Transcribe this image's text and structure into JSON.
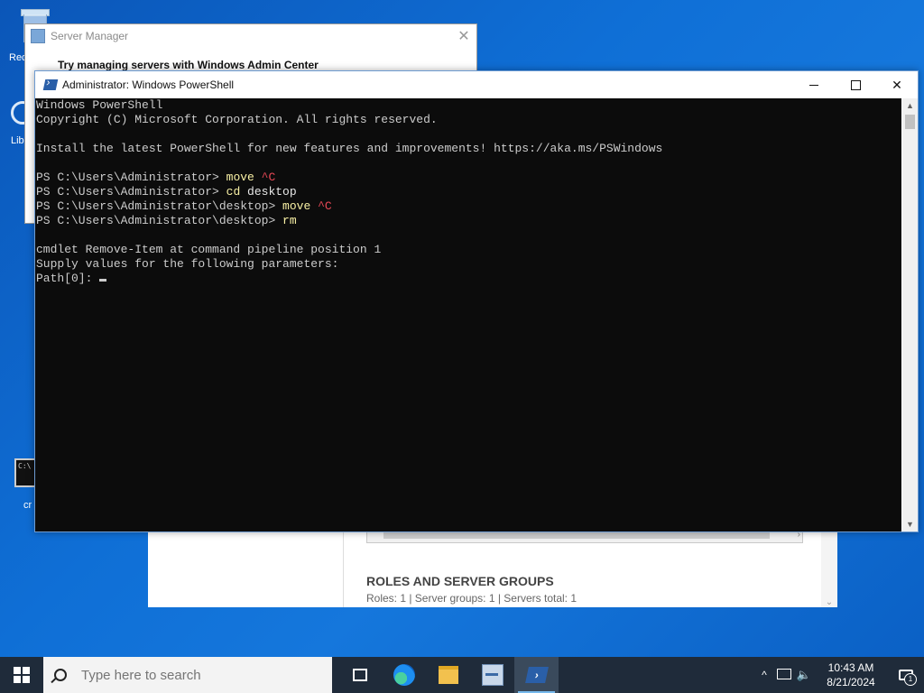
{
  "desktop": {
    "icons": [
      {
        "label": "Rec"
      },
      {
        "label": "Lib"
      },
      {
        "label": "cr"
      }
    ],
    "cmd_icon_text": "C:\\"
  },
  "server_manager": {
    "title": "Server Manager",
    "banner": "Try managing servers with Windows Admin Center",
    "roles_title": "ROLES AND SERVER GROUPS",
    "roles_meta": "Roles: 1   |   Server groups: 1   |   Servers total: 1"
  },
  "powershell": {
    "title": "Administrator: Windows PowerShell",
    "lines": [
      {
        "text": "Windows PowerShell"
      },
      {
        "text": "Copyright (C) Microsoft Corporation. All rights reserved."
      },
      {
        "text": ""
      },
      {
        "text": "Install the latest PowerShell for new features and improvements! https://aka.ms/PSWindows"
      },
      {
        "text": ""
      },
      {
        "prompt": "PS C:\\Users\\Administrator> ",
        "cmd": "move",
        "arg": " ^C"
      },
      {
        "prompt": "PS C:\\Users\\Administrator> ",
        "cmd": "cd",
        "arg2": " desktop"
      },
      {
        "prompt": "PS C:\\Users\\Administrator\\desktop> ",
        "cmd": "move",
        "arg": " ^C"
      },
      {
        "prompt": "PS C:\\Users\\Administrator\\desktop> ",
        "cmd": "rm"
      },
      {
        "text": ""
      },
      {
        "text": "cmdlet Remove-Item at command pipeline position 1"
      },
      {
        "text": "Supply values for the following parameters:"
      },
      {
        "text": "Path[0]: ",
        "cursor": true
      }
    ]
  },
  "taskbar": {
    "search_placeholder": "Type here to search",
    "time": "10:43 AM",
    "date": "8/21/2024",
    "notification_count": "1"
  }
}
